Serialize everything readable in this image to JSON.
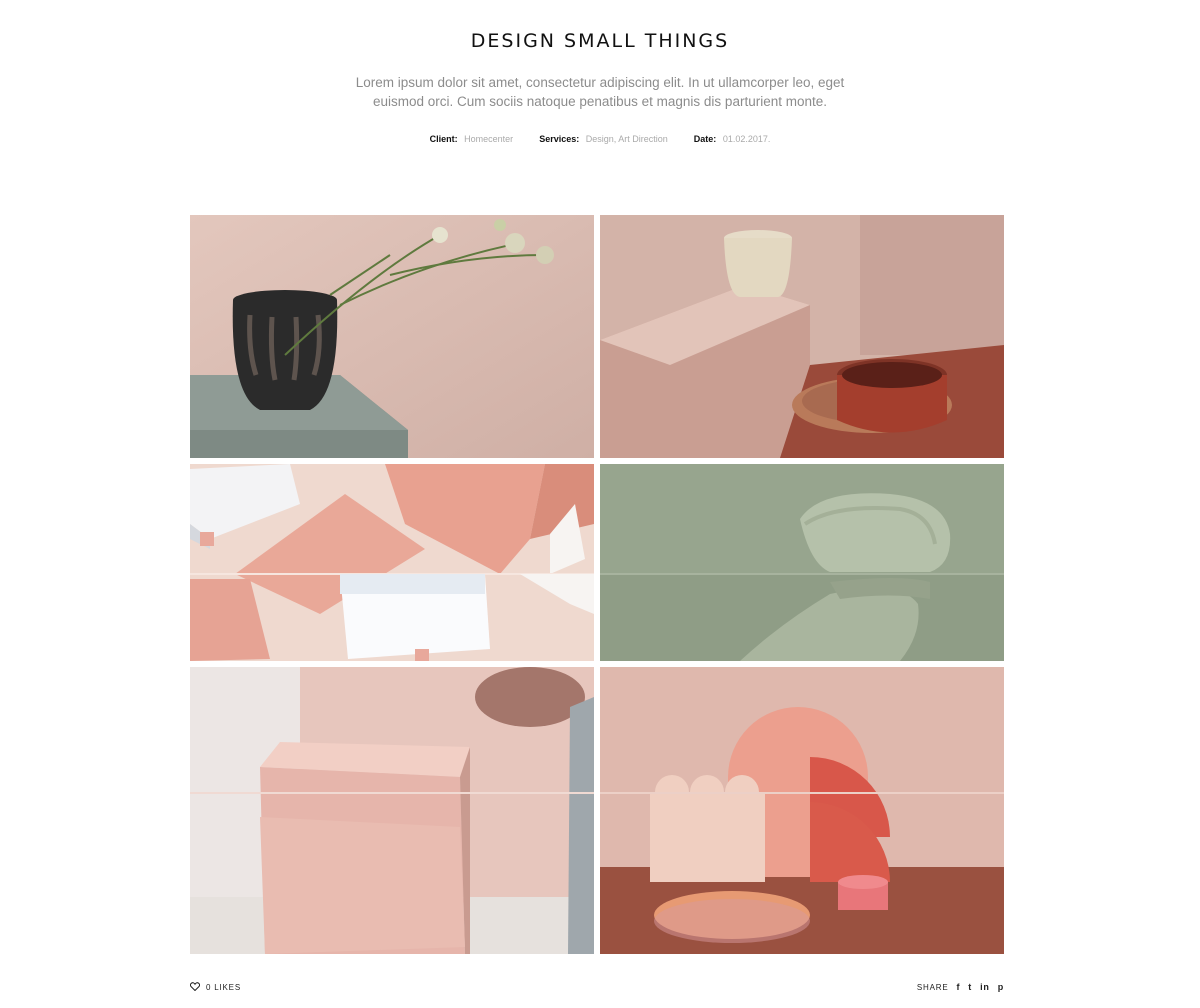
{
  "project": {
    "title": "DESIGN SMALL THINGS",
    "description": "Lorem ipsum dolor sit amet, consectetur adipiscing elit. In ut ullamcorper leo, eget euismod orci. Cum sociis natoque penatibus et magnis dis parturient monte.",
    "meta": [
      {
        "label": "Client:",
        "value": "Homecenter"
      },
      {
        "label": "Services:",
        "value": "Design, Art Direction"
      },
      {
        "label": "Date:",
        "value": "01.02.2017."
      }
    ]
  },
  "gallery": {
    "images": [
      {
        "name": "black-vase-with-flowers"
      },
      {
        "name": "cup-and-bowls"
      },
      {
        "name": "pink-boxes"
      },
      {
        "name": "green-chair"
      },
      {
        "name": "pink-cubes"
      },
      {
        "name": "pink-shapes"
      }
    ]
  },
  "footer": {
    "likes_icon": "heart-icon",
    "likes": "0 LIKES",
    "share_label": "SHARE",
    "social": [
      {
        "icon": "facebook-icon",
        "glyph": "f"
      },
      {
        "icon": "twitter-icon",
        "glyph": "t"
      },
      {
        "icon": "linkedin-icon",
        "glyph": "in"
      },
      {
        "icon": "pinterest-icon",
        "glyph": "p"
      }
    ]
  }
}
